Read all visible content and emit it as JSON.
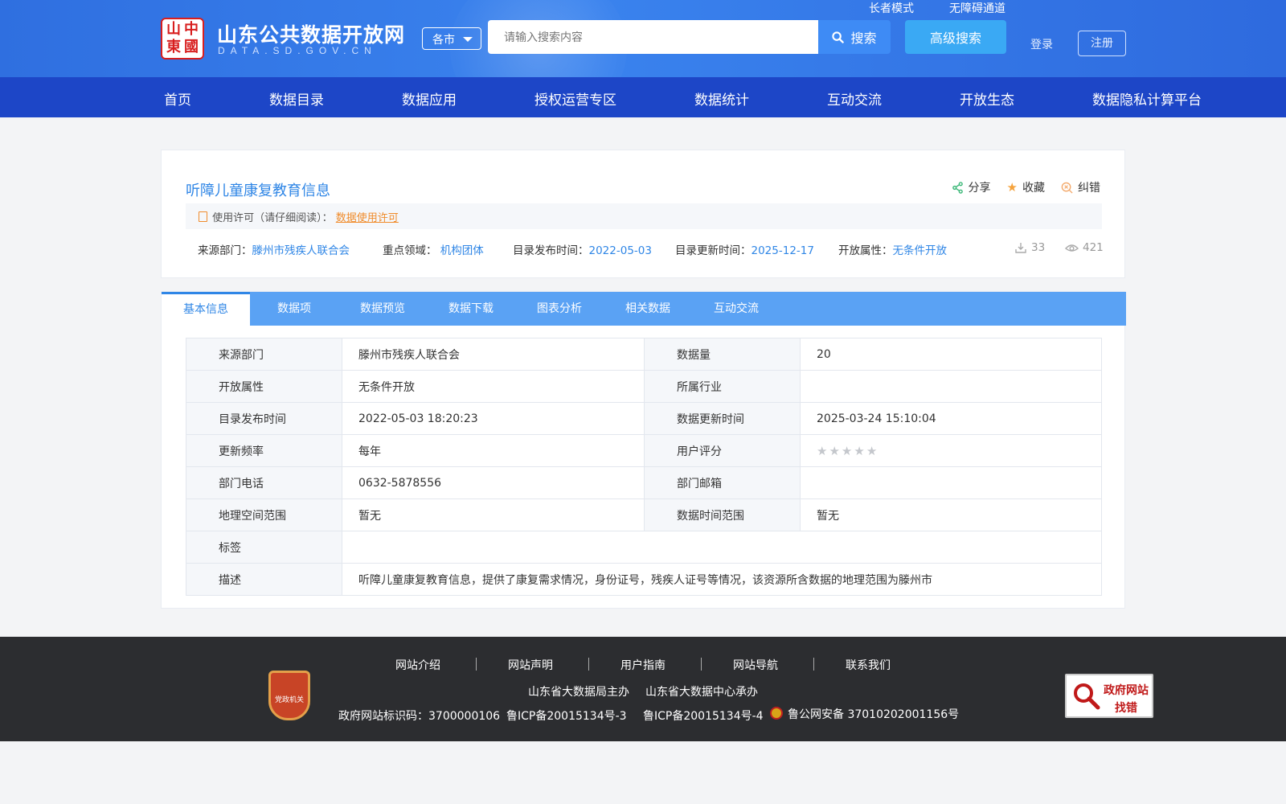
{
  "header": {
    "site_title": "山东公共数据开放网",
    "site_subtitle": "DATA.SD.GOV.CN",
    "seal_chars": [
      "中",
      "國",
      "山",
      "東"
    ],
    "city_select": "各市",
    "search_placeholder": "请输入搜索内容",
    "search_button": "搜索",
    "advanced_search": "高级搜索",
    "elder_mode": "长者模式",
    "accessibility": "无障碍通道",
    "login": "登录",
    "register": "注册"
  },
  "nav": [
    "首页",
    "数据目录",
    "数据应用",
    "授权运营专区",
    "数据统计",
    "互动交流",
    "开放生态",
    "数据隐私计算平台"
  ],
  "dataset": {
    "title": "听障儿童康复教育信息",
    "actions": {
      "share": "分享",
      "favorite": "收藏",
      "report": "纠错"
    },
    "license_label": "使用许可（请仔细阅读）：",
    "license_link": "数据使用许可",
    "meta": {
      "source_label": "来源部门：",
      "source_value": "滕州市残疾人联合会",
      "domain_label": "重点领域：",
      "domain_value": "机构团体",
      "publish_label": "目录发布时间：",
      "publish_value": "2022-05-03",
      "update_label": "目录更新时间：",
      "update_value": "2025-12-17",
      "open_label": "开放属性：",
      "open_value": "无条件开放"
    },
    "downloads": "33",
    "views": "421"
  },
  "tabs": [
    "基本信息",
    "数据项",
    "数据预览",
    "数据下载",
    "图表分析",
    "相关数据",
    "互动交流"
  ],
  "info": {
    "r1": {
      "l1": "来源部门",
      "v1": "滕州市残疾人联合会",
      "l2": "数据量",
      "v2": "20"
    },
    "r2": {
      "l1": "开放属性",
      "v1": "无条件开放",
      "l2": "所属行业",
      "v2": ""
    },
    "r3": {
      "l1": "目录发布时间",
      "v1": "2022-05-03 18:20:23",
      "l2": "数据更新时间",
      "v2": "2025-03-24 15:10:04"
    },
    "r4": {
      "l1": "更新频率",
      "v1": "每年",
      "l2": "用户评分",
      "rating": 0
    },
    "r5": {
      "l1": "部门电话",
      "v1": "0632-5878556",
      "l2": "部门邮箱",
      "v2": ""
    },
    "r6": {
      "l1": "地理空间范围",
      "v1": "暂无",
      "l2": "数据时间范围",
      "v2": "暂无"
    },
    "r7": {
      "l1": "标签",
      "v1": ""
    },
    "r8": {
      "l1": "描述",
      "v1": "听障儿童康复教育信息，提供了康复需求情况，身份证号，残疾人证号等情况，该资源所含数据的地理范围为滕州市"
    }
  },
  "footer": {
    "links": [
      "网站介绍",
      "网站声明",
      "用户指南",
      "网站导航",
      "联系我们"
    ],
    "host": "山东省大数据局主办",
    "undertaker": "山东省大数据中心承办",
    "gov_id": "政府网站标识码：3700000106",
    "icp3": "鲁ICP备20015134号-3",
    "icp4": "鲁ICP备20015134号-4",
    "police": "鲁公网安备 37010202001156号",
    "badge_text": "党政机关",
    "gov_find_1": "政府网站",
    "gov_find_2": "找错"
  },
  "colors": {
    "primary": "#2f86e6",
    "nav": "#1d46c7",
    "tab_bar": "#5aa2f4",
    "license_link": "#f08c2c"
  }
}
